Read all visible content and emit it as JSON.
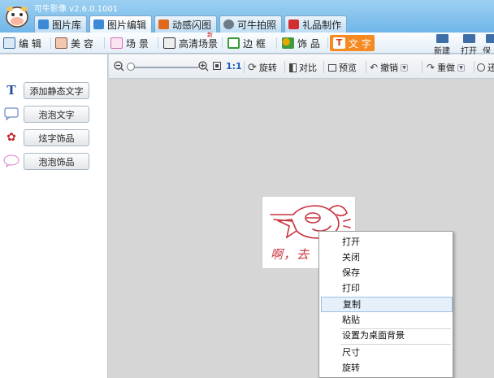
{
  "app": {
    "title": "可牛影像 v2.6.0.1001"
  },
  "top_tabs": [
    {
      "label": "图片库",
      "icon": "gallery-icon",
      "color": "#3a8ad8"
    },
    {
      "label": "图片编辑",
      "icon": "photo-edit-icon",
      "color": "#3a8ad8"
    },
    {
      "label": "动感闪图",
      "icon": "film-icon",
      "color": "#e06a1c"
    },
    {
      "label": "可牛拍照",
      "icon": "webcam-icon",
      "color": "#6e7c88"
    },
    {
      "label": "礼品制作",
      "icon": "gift-icon",
      "color": "#d23030"
    }
  ],
  "functions": [
    {
      "label": "编 辑",
      "icon": "edit-icon"
    },
    {
      "label": "美 容",
      "icon": "face-icon"
    },
    {
      "label": "场 景",
      "icon": "scene-icon"
    },
    {
      "label": "高清场景",
      "icon": "hd-scene-icon",
      "badge": "新"
    },
    {
      "label": "边 框",
      "icon": "frame-icon"
    },
    {
      "label": "饰 品",
      "icon": "decoration-icon"
    },
    {
      "label": "文 字",
      "icon": "text-icon"
    }
  ],
  "file_buttons": {
    "new": "新建",
    "open": "打开",
    "save": "保"
  },
  "edit_tools": {
    "fit": "1:1",
    "rotate": "旋转",
    "compare": "对比",
    "preview": "预览",
    "undo": "撤销",
    "redo": "重做",
    "restore": "还"
  },
  "left_panel": {
    "items": [
      {
        "label": "添加静态文字",
        "icon": "static-text-icon"
      },
      {
        "label": "泡泡文字",
        "icon": "bubble-text-icon"
      },
      {
        "label": "炫字饰品",
        "icon": "fancy-text-icon"
      },
      {
        "label": "泡泡饰品",
        "icon": "bubble-decoration-icon"
      }
    ]
  },
  "photo": {
    "caption": "啊，去"
  },
  "context_menu": {
    "items": [
      "打开",
      "关闭",
      "保存",
      "打印",
      "复制",
      "粘贴",
      "设置为桌面背景",
      "尺寸",
      "旋转"
    ],
    "highlighted": "复制"
  },
  "colors": {
    "accent": "#f58a22",
    "title_bar": "#7fbde9",
    "canvas": "#d6d6d6",
    "sketch": "#c8333e"
  }
}
